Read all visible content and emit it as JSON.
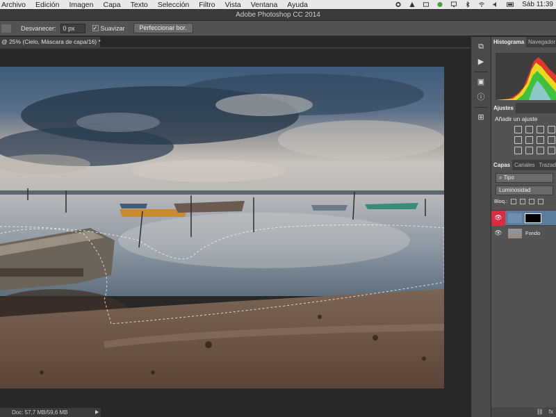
{
  "menubar": {
    "items": [
      "Archivo",
      "Edición",
      "Imagen",
      "Capa",
      "Texto",
      "Selección",
      "Filtro",
      "Vista",
      "Ventana",
      "Ayuda"
    ],
    "clock": "Sáb 11:39"
  },
  "window": {
    "title": "Adobe Photoshop CC 2014"
  },
  "options": {
    "feather_label": "Desvanecer:",
    "feather_value": "0 px",
    "antialias_label": "Suavizar",
    "antialias_checked": true,
    "refine_button": "Perfeccionar bor."
  },
  "document": {
    "tab_title": "@ 25% (Cielo, Máscara de capa/16) *",
    "status": "Doc: 57,7 MB/59,6 MB"
  },
  "panels": {
    "histogram_tabs": [
      "Histograma",
      "Navegador"
    ],
    "adjustments_tab": "Ajustes",
    "adjustments_title": "Añadir un ajuste",
    "layers_tabs": [
      "Capas",
      "Canales",
      "Trazados"
    ],
    "filter_kind": "Tipo",
    "blend_mode": "Luminosidad",
    "lock_label": "Bloq.:",
    "layers": [
      {
        "name": "",
        "selected": true
      },
      {
        "name": "Fondo",
        "selected": false
      }
    ],
    "bottom_icons": [
      "link-icon",
      "fx-icon"
    ]
  },
  "colors": {
    "selected_layer_eye": "#d92c3f",
    "selected_layer_bg": "#5a7d9e",
    "histogram_yellow": "#e8d81e",
    "histogram_red": "#e0372f",
    "histogram_green": "#40c040"
  }
}
